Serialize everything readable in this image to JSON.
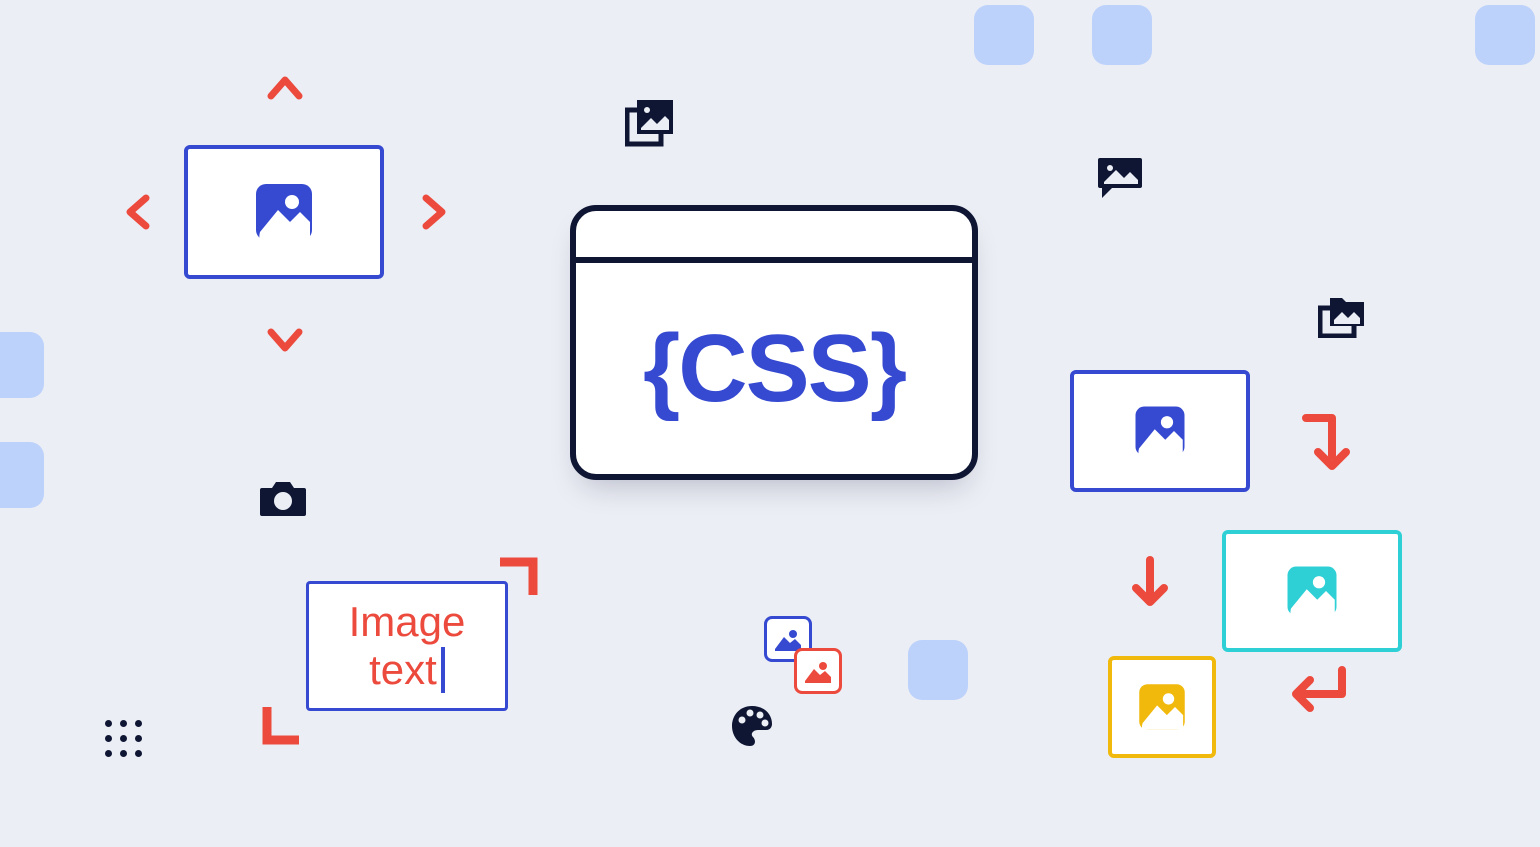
{
  "center": {
    "label": "{CSS}"
  },
  "image_text": {
    "line1": "Image",
    "line2": "text"
  },
  "icons": {
    "stacked_pictures": "stacked-pictures-icon",
    "chat_image": "chat-image-icon",
    "camera": "camera-icon",
    "palette": "palette-icon",
    "folder_stack": "folder-stack-icon",
    "dots": "dots-grid-icon"
  },
  "colors": {
    "primary": "#3549d1",
    "dark": "#0e1633",
    "red": "#ec4a3d",
    "teal": "#2ed0d6",
    "yellow": "#f0b90c",
    "softblue": "#bdd2fb",
    "bg": "#eceef5"
  }
}
